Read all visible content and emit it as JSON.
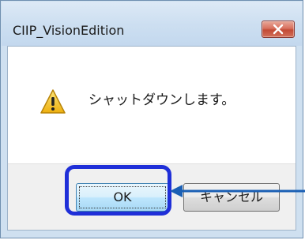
{
  "dialog": {
    "title": "CIIP_VisionEdition",
    "message": "シャットダウンします。",
    "icon": "warning-icon",
    "buttons": {
      "ok_label": "OK",
      "cancel_label": "キャンセル"
    }
  },
  "colors": {
    "highlight": "#1f2fd8",
    "arrow": "#1a5fb4",
    "warning_yellow": "#f2c11d"
  }
}
